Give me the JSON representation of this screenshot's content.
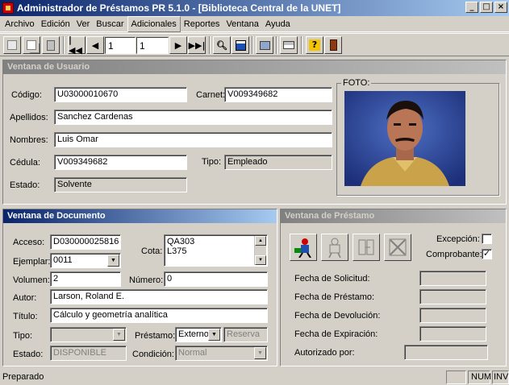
{
  "window": {
    "title": "Administrador de Préstamos PR 5.1.0 - [Biblioteca Central de la UNET]",
    "min": "_",
    "max": "□",
    "close": "×"
  },
  "menu": [
    "Archivo",
    "Edición",
    "Ver",
    "Buscar",
    "Adicionales",
    "Reportes",
    "Ventana",
    "Ayuda"
  ],
  "toolbar": {
    "record": "1",
    "total": "1"
  },
  "usuario": {
    "header": "Ventana de Usuario",
    "codigo_label": "Código:",
    "codigo": "U03000010670",
    "carnet_label": "Carnet:",
    "carnet": "V009349682",
    "apellidos_label": "Apellidos:",
    "apellidos": "Sanchez Cardenas",
    "nombres_label": "Nombres:",
    "nombres": "Luis Omar",
    "cedula_label": "Cédula:",
    "cedula": "V009349682",
    "tipo_label": "Tipo:",
    "tipo": "Empleado",
    "estado_label": "Estado:",
    "estado": "Solvente",
    "foto_label": "FOTO:"
  },
  "documento": {
    "header": "Ventana de Documento",
    "acceso_label": "Acceso:",
    "acceso": "D030000025816",
    "cota_label": "Cota:",
    "cota_lines": [
      "QA303",
      "L375"
    ],
    "ejemplar_label": "Ejemplar:",
    "ejemplar": "0011",
    "volumen_label": "Volumen:",
    "volumen": "2",
    "numero_label": "Número:",
    "numero": "0",
    "autor_label": "Autor:",
    "autor": "Larson, Roland E.",
    "titulo_label": "Título:",
    "titulo": "Cálculo y geometría analítica",
    "tipo_label": "Tipo:",
    "tipo": "",
    "prestamo_label": "Préstamo:",
    "prestamo": "Externo",
    "reserva": "Reserva",
    "estado_label": "Estado:",
    "estado": "DISPONIBLE",
    "condicion_label": "Condición:",
    "condicion": "Normal"
  },
  "prestamo": {
    "header": "Ventana de Préstamo",
    "excepcion_label": "Excepción:",
    "excepcion_checked": false,
    "comprobante_label": "Comprobante:",
    "comprobante_checked": true,
    "fecha_solicitud_label": "Fecha de Solicitud:",
    "fecha_prestamo_label": "Fecha de Préstamo:",
    "fecha_devolucion_label": "Fecha de Devolución:",
    "fecha_expiracion_label": "Fecha de Expiración:",
    "autorizado_label": "Autorizado por:"
  },
  "status": {
    "text": "Preparado",
    "num": "NUM",
    "ins": "INV"
  }
}
